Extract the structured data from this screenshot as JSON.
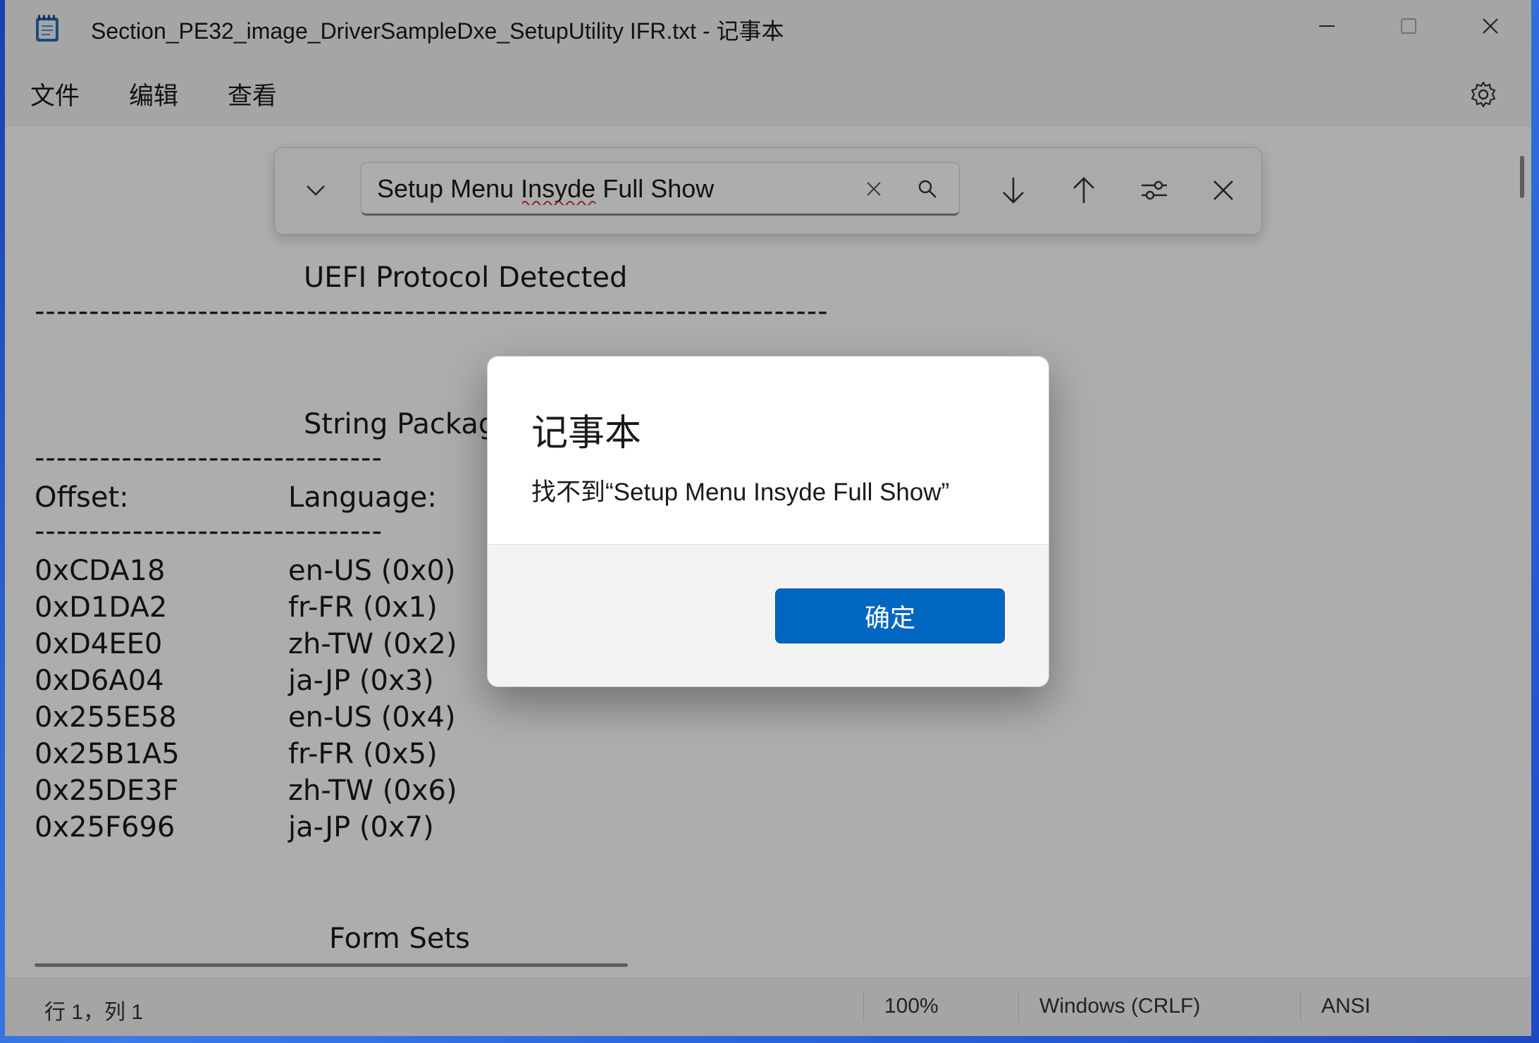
{
  "window": {
    "title": "Section_PE32_image_DriverSampleDxe_SetupUtility IFR.txt - 记事本"
  },
  "menu": {
    "items": [
      "文件",
      "编辑",
      "查看"
    ]
  },
  "find": {
    "query": "Setup Menu Insyde Full Show"
  },
  "document": {
    "lines": [
      "UEFI Protocol Detected",
      "-------------------------------------------------------------------------",
      "String Package",
      "--------------------------------",
      "Offset:",
      "Language:",
      "--------------------------------",
      "Form Sets"
    ],
    "offsets": [
      "0xCDA18",
      "0xD1DA2",
      "0xD4EE0",
      "0xD6A04",
      "0x255E58",
      "0x25B1A5",
      "0x25DE3F",
      "0x25F696"
    ],
    "languages": [
      "en-US (0x0)",
      "fr-FR (0x1)",
      "zh-TW (0x2)",
      "ja-JP (0x3)",
      "en-US (0x4)",
      "fr-FR (0x5)",
      "zh-TW (0x6)",
      "ja-JP (0x7)"
    ]
  },
  "status": {
    "position": "行 1，列 1",
    "zoom": "100%",
    "line_ending": "Windows (CRLF)",
    "encoding": "ANSI"
  },
  "dialog": {
    "title": "记事本",
    "message": "找不到“Setup Menu Insyde Full Show”",
    "ok_label": "确定"
  },
  "colors": {
    "accent": "#0067c0",
    "spellcheck": "#d13438"
  },
  "icons": [
    "notepad-app-icon",
    "minimize-icon",
    "maximize-icon",
    "close-icon",
    "settings-gear-icon",
    "chevron-down-icon",
    "clear-icon",
    "search-icon",
    "arrow-down-icon",
    "arrow-up-icon",
    "options-sliders-icon",
    "close-find-icon"
  ]
}
